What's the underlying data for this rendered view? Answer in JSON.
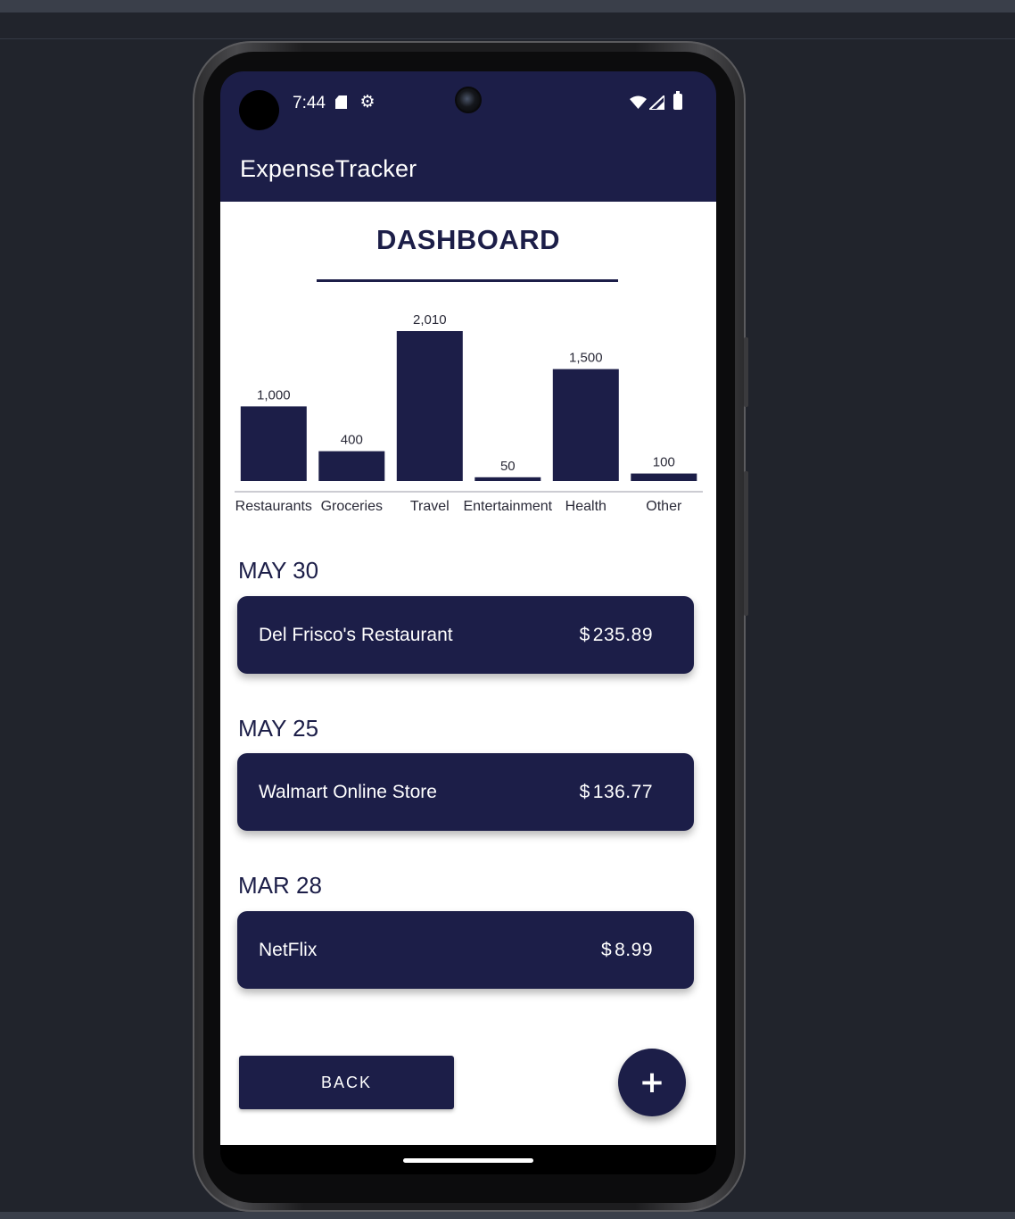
{
  "status_bar": {
    "time": "7:44"
  },
  "app": {
    "title": "ExpenseTracker"
  },
  "dashboard": {
    "title": "DASHBOARD"
  },
  "chart_data": {
    "type": "bar",
    "categories": [
      "Restaurants",
      "Groceries",
      "Travel",
      "Entertainment",
      "Health",
      "Other"
    ],
    "values": [
      1000,
      400,
      2010,
      50,
      1500,
      100
    ],
    "value_labels": [
      "1,000",
      "400",
      "2,010",
      "50",
      "1,500",
      "100"
    ],
    "title": "",
    "xlabel": "",
    "ylabel": "",
    "ylim": [
      0,
      2010
    ],
    "grid": false,
    "bar_color": "#1c1e48"
  },
  "transactions": [
    {
      "date": "MAY 30",
      "merchant": "Del Frisco's Restaurant",
      "currency": "$",
      "amount": "235.89"
    },
    {
      "date": "MAY 25",
      "merchant": "Walmart Online Store",
      "currency": "$",
      "amount": "136.77"
    },
    {
      "date": "MAR 28",
      "merchant": "NetFlix",
      "currency": "$",
      "amount": "8.99"
    }
  ],
  "actions": {
    "back_label": "BACK",
    "fab_icon": "plus-icon",
    "fab_symbol": "+"
  },
  "colors": {
    "primary": "#1c1e48",
    "surface": "#ffffff",
    "on_primary": "#ffffff"
  }
}
